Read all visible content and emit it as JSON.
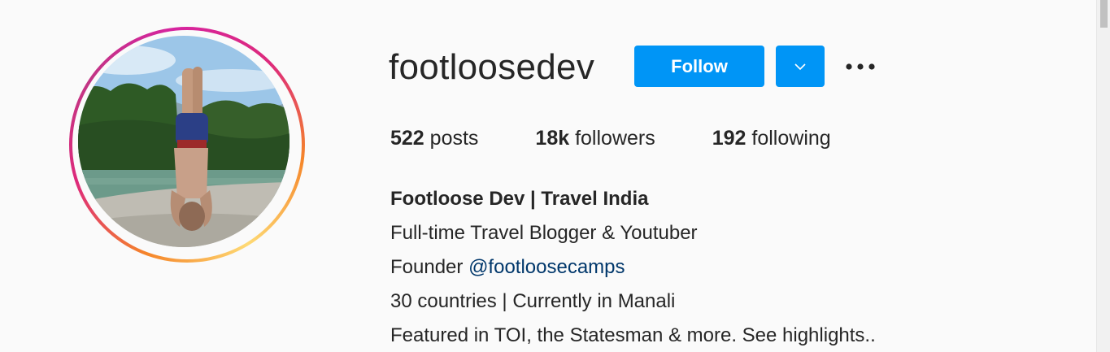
{
  "profile": {
    "username": "footloosedev",
    "follow_label": "Follow",
    "avatar_icon": "profile-photo"
  },
  "stats": {
    "posts_count": "522",
    "posts_label": " posts",
    "followers_count": "18k",
    "followers_label": " followers",
    "following_count": "192",
    "following_label": " following"
  },
  "bio": {
    "name": "Footloose Dev | Travel India",
    "line1": "Full-time Travel Blogger & Youtuber",
    "line2_prefix": "Founder ",
    "line2_link": "@footloosecamps",
    "line3": "30 countries | Currently in Manali",
    "line4": "Featured in TOI, the Statesman & more. See highlights.."
  },
  "colors": {
    "accent": "#0095f6",
    "link": "#00376b",
    "background": "#fafafa",
    "text": "#262626"
  }
}
